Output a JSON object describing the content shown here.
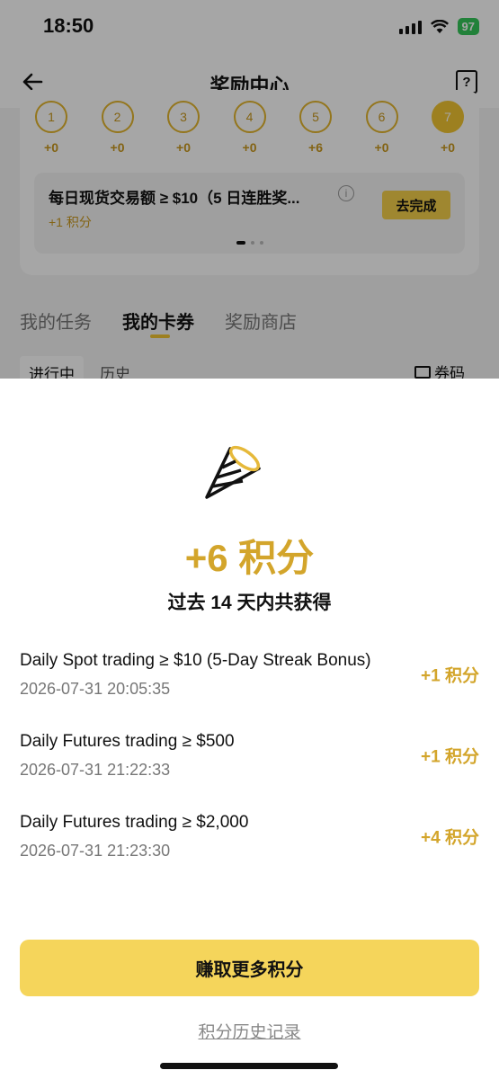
{
  "status_bar": {
    "time": "18:50",
    "battery": "97"
  },
  "nav": {
    "title": "奖励中心"
  },
  "streak": {
    "days": [
      {
        "label": "1",
        "points": "+0"
      },
      {
        "label": "2",
        "points": "+0"
      },
      {
        "label": "3",
        "points": "+0"
      },
      {
        "label": "4",
        "points": "+0"
      },
      {
        "label": "5",
        "points": "+6"
      },
      {
        "label": "6",
        "points": "+0"
      },
      {
        "label": "7",
        "points": "+0"
      }
    ]
  },
  "task": {
    "title": "每日现货交易额 ≥ $10（5 日连胜奖...",
    "points": "+1 积分",
    "button": "去完成"
  },
  "tabs": [
    "我的任务",
    "我的卡券",
    "奖励商店"
  ],
  "subtabs": [
    "进行中",
    "历史"
  ],
  "coupon_link": "券码",
  "sheet": {
    "total": "+6 积分",
    "subtitle": "过去 14 天内共获得",
    "records": [
      {
        "title": "Daily Spot trading ≥ $10 (5-Day Streak Bonus)",
        "time": "2026-07-31 20:05:35",
        "points": "+1 积分"
      },
      {
        "title": "Daily Futures trading ≥ $500",
        "time": "2026-07-31 21:22:33",
        "points": "+1 积分"
      },
      {
        "title": "Daily Futures trading ≥ $2,000",
        "time": "2026-07-31 21:23:30",
        "points": "+4 积分"
      }
    ],
    "earn_button": "赚取更多积分",
    "history_link": "积分历史记录"
  },
  "colors": {
    "accent": "#d3a52b",
    "button": "#f5d55b"
  }
}
